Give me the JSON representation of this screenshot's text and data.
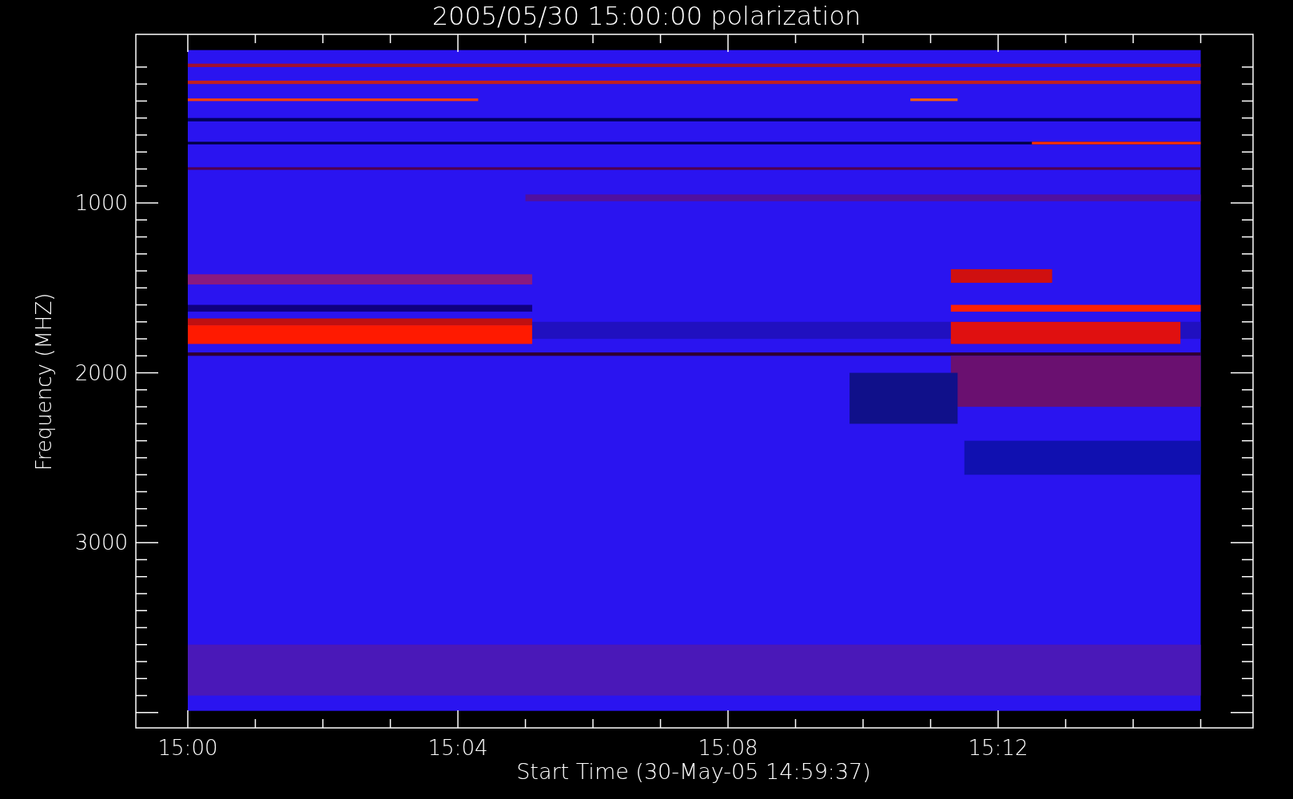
{
  "title": "2005/05/30 15:00:00 polarization",
  "x_axis": {
    "label": "Start Time (30-May-05 14:59:37)",
    "ticks": [
      "15:00",
      "15:04",
      "15:08",
      "15:12"
    ]
  },
  "y_axis": {
    "label": "Frequency (MHZ)",
    "ticks": [
      "1000",
      "2000",
      "3000"
    ]
  }
}
